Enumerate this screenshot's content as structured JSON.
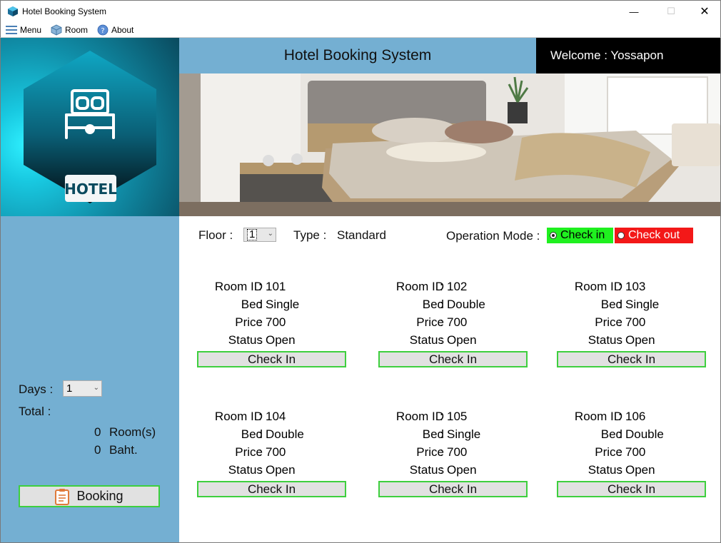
{
  "window": {
    "title": "Hotel Booking System",
    "minimize": "—",
    "maximize": "☐",
    "close": "✕"
  },
  "menu": [
    {
      "label": "Menu",
      "icon": "list-icon"
    },
    {
      "label": "Room",
      "icon": "cube-icon"
    },
    {
      "label": "About",
      "icon": "help-icon"
    }
  ],
  "header": {
    "title": "Hotel Booking System",
    "welcome": "Welcome : Yossapon"
  },
  "logo": {
    "text": "HOTEL"
  },
  "filters": {
    "floor_label": "Floor :",
    "floor_value": "1",
    "type_label": "Type :",
    "type_value": "Standard",
    "mode_label": "Operation Mode :",
    "mode_check_in": "Check in",
    "mode_check_out": "Check out",
    "mode_selected": "Check in"
  },
  "room_labels": {
    "room_id": "Room ID",
    "bed": "Bed",
    "price": "Price",
    "status": "Status",
    "colon": ":"
  },
  "rooms": [
    {
      "id": "101",
      "bed": "Single",
      "price": "700",
      "status": "Open",
      "button": "Check In"
    },
    {
      "id": "102",
      "bed": "Double",
      "price": "700",
      "status": "Open",
      "button": "Check In"
    },
    {
      "id": "103",
      "bed": "Single",
      "price": "700",
      "status": "Open",
      "button": "Check In"
    },
    {
      "id": "104",
      "bed": "Double",
      "price": "700",
      "status": "Open",
      "button": "Check In"
    },
    {
      "id": "105",
      "bed": "Single",
      "price": "700",
      "status": "Open",
      "button": "Check In"
    },
    {
      "id": "106",
      "bed": "Double",
      "price": "700",
      "status": "Open",
      "button": "Check In"
    }
  ],
  "sidebar": {
    "days_label": "Days :",
    "days_value": "1",
    "total_label": "Total :",
    "rooms_count": "0",
    "rooms_unit": "Room(s)",
    "baht_amount": "0",
    "baht_unit": "Baht.",
    "booking_button": "Booking"
  },
  "colors": {
    "sidebar_blue": "#74afd2",
    "check_in_green": "#1ff01f",
    "check_out_red": "#f31818",
    "button_border_green": "#3ecf3e"
  }
}
